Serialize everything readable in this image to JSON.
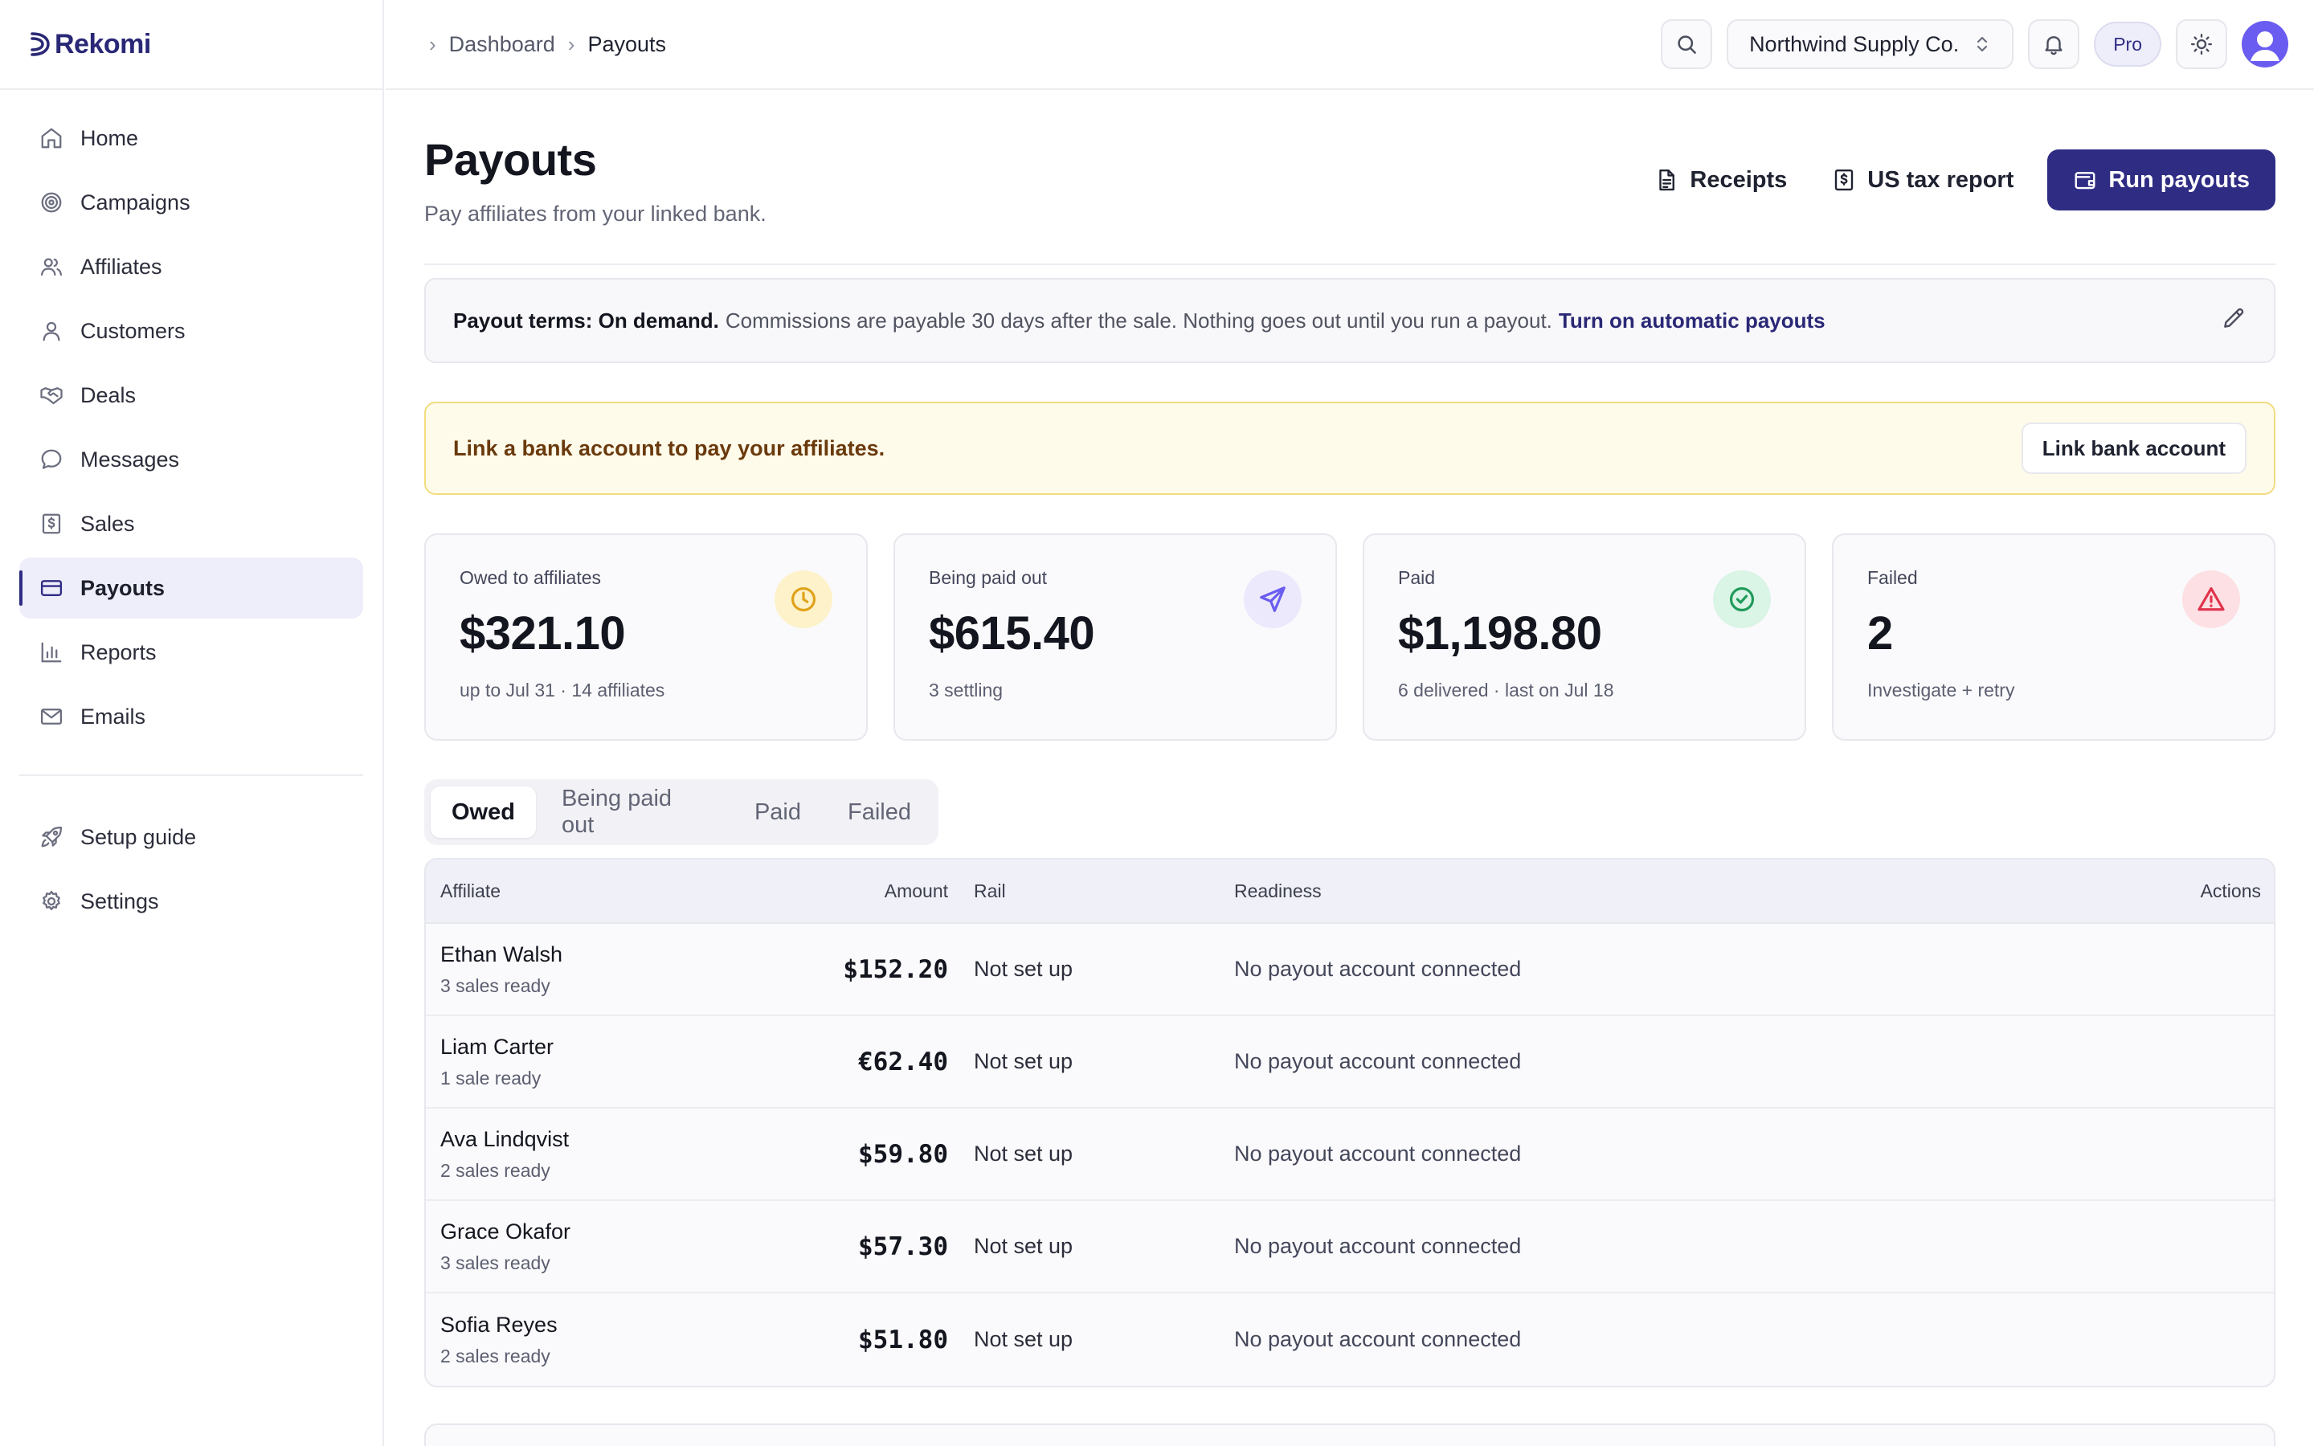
{
  "brand": {
    "name": "Rekomi"
  },
  "sidebar": {
    "items": [
      {
        "label": "Home",
        "icon": "home-icon"
      },
      {
        "label": "Campaigns",
        "icon": "target-icon"
      },
      {
        "label": "Affiliates",
        "icon": "users-icon"
      },
      {
        "label": "Customers",
        "icon": "user-icon"
      },
      {
        "label": "Deals",
        "icon": "handshake-icon"
      },
      {
        "label": "Messages",
        "icon": "chat-icon"
      },
      {
        "label": "Sales",
        "icon": "receipt-dollar-icon"
      },
      {
        "label": "Payouts",
        "icon": "credit-card-icon",
        "active": true
      },
      {
        "label": "Reports",
        "icon": "bar-chart-icon"
      },
      {
        "label": "Emails",
        "icon": "mail-icon"
      }
    ],
    "footer_items": [
      {
        "label": "Setup guide",
        "icon": "rocket-icon"
      },
      {
        "label": "Settings",
        "icon": "gear-icon"
      }
    ]
  },
  "topbar": {
    "breadcrumb": [
      "Dashboard",
      "Payouts"
    ],
    "org": "Northwind Supply Co.",
    "plan_badge": "Pro"
  },
  "page": {
    "title": "Payouts",
    "subtitle": "Pay affiliates from your linked bank.",
    "actions": {
      "receipts": "Receipts",
      "tax_report": "US tax report",
      "run": "Run payouts"
    }
  },
  "terms": {
    "label": "Payout terms: On demand.",
    "text": "Commissions are payable 30 days after the sale. Nothing goes out until you run a payout.",
    "link": "Turn on automatic payouts"
  },
  "alert": {
    "message": "Link a bank account to pay your affiliates.",
    "button": "Link bank account"
  },
  "stats": [
    {
      "label": "Owed to affiliates",
      "value": "$321.10",
      "note": "up to Jul 31 · 14 affiliates",
      "icon": "clock-icon",
      "color": "#e0a21a",
      "bg": "#fdf2c9"
    },
    {
      "label": "Being paid out",
      "value": "$615.40",
      "note": "3 settling",
      "icon": "send-icon",
      "color": "#6a5cf0",
      "bg": "#ebe9fb"
    },
    {
      "label": "Paid",
      "value": "$1,198.80",
      "note": "6 delivered · last on Jul 18",
      "icon": "check-circle-icon",
      "color": "#1f9a5a",
      "bg": "#daf4e5"
    },
    {
      "label": "Failed",
      "value": "2",
      "note": "Investigate + retry",
      "icon": "warning-icon",
      "color": "#e0344c",
      "bg": "#fde0e4"
    }
  ],
  "tabs": [
    "Owed",
    "Being paid out",
    "Paid",
    "Failed"
  ],
  "active_tab": "Owed",
  "table": {
    "headers": {
      "affiliate": "Affiliate",
      "amount": "Amount",
      "rail": "Rail",
      "readiness": "Readiness",
      "actions": "Actions"
    },
    "rows": [
      {
        "name": "Ethan Walsh",
        "sub": "3 sales ready",
        "amount": "$152.20",
        "rail": "Not set up",
        "readiness": "No payout account connected"
      },
      {
        "name": "Liam Carter",
        "sub": "1 sale ready",
        "amount": "€62.40",
        "rail": "Not set up",
        "readiness": "No payout account connected"
      },
      {
        "name": "Ava Lindqvist",
        "sub": "2 sales ready",
        "amount": "$59.80",
        "rail": "Not set up",
        "readiness": "No payout account connected"
      },
      {
        "name": "Grace Okafor",
        "sub": "3 sales ready",
        "amount": "$57.30",
        "rail": "Not set up",
        "readiness": "No payout account connected"
      },
      {
        "name": "Sofia Reyes",
        "sub": "2 sales ready",
        "amount": "$51.80",
        "rail": "Not set up",
        "readiness": "No payout account connected"
      }
    ]
  }
}
